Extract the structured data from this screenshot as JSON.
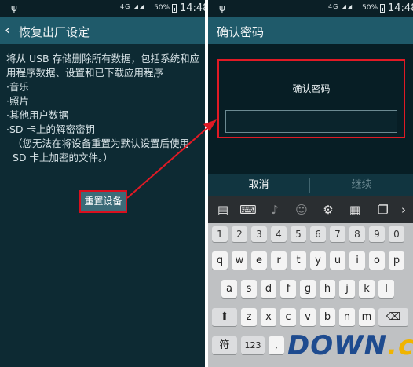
{
  "status_bar": {
    "network": "4G",
    "battery": "50%",
    "time": "14:48"
  },
  "left_screen": {
    "title": "恢复出厂设定",
    "description_lines": [
      "将从 USB 存储删除所有数据，包括系统和应用程序数据、设置和已下载应用程序",
      "·音乐",
      "·照片",
      "·其他用户数据",
      "·SD 卡上的解密密钥",
      "（您无法在将设备重置为默认设置后使用 SD 卡上加密的文件。）"
    ],
    "reset_button": "重置设备"
  },
  "right_screen": {
    "title": "确认密码",
    "dialog_title": "确认密码",
    "password_value": "",
    "cancel_button": "取消",
    "continue_button": "继续"
  },
  "keyboard": {
    "toolbar_icons": [
      "clipboard-icon",
      "keyboard-icon",
      "mic-icon",
      "emoji-icon",
      "settings-icon",
      "keyboard-resize-icon",
      "split-window-icon"
    ],
    "number_row": [
      "1",
      "2",
      "3",
      "4",
      "5",
      "6",
      "7",
      "8",
      "9",
      "0"
    ],
    "row1": [
      "q",
      "w",
      "e",
      "r",
      "t",
      "y",
      "u",
      "i",
      "o",
      "p"
    ],
    "row2": [
      "a",
      "s",
      "d",
      "f",
      "g",
      "h",
      "j",
      "k",
      "l"
    ],
    "row3": [
      "z",
      "x",
      "c",
      "v",
      "b",
      "n",
      "m"
    ],
    "bottom": {
      "symbols": "符",
      "numbers": "123",
      "comma": ","
    }
  },
  "watermark": {
    "part1": "DOWN",
    "part2": ".cc"
  },
  "colors": {
    "accent_red": "#e01a25",
    "action_bar": "#1f5a6a",
    "screen_bg": "#0d2a33"
  }
}
